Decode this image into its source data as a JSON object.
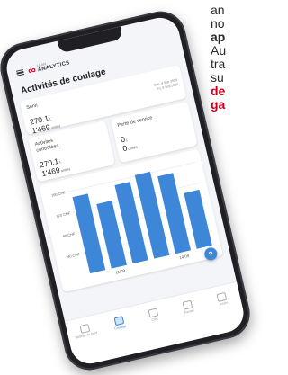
{
  "side_text": {
    "line1": "an",
    "line2": "no",
    "line3": "ap",
    "line4": "Au",
    "line5": "tra",
    "line6": "su",
    "line7": "de",
    "line8": "ga"
  },
  "app": {
    "logo_small": "LEAN",
    "logo_big": "ANALYTICS",
    "title": "Activités de coulage"
  },
  "servi": {
    "label": "Servi",
    "value1": "270.1",
    "unit1": "L",
    "value2": "1'469",
    "unit2": "unités",
    "date1": "Mon, 4 Sep 2023",
    "date2": "Fri, 8 Sep 2023"
  },
  "activites": {
    "label_line1": "Activités",
    "label_line2": "contrôlées",
    "value1": "270.1",
    "unit1": "L",
    "value2": "1'469",
    "unit2": "unités"
  },
  "perte": {
    "label": "Perte de service",
    "value1": "0",
    "unit1": "L",
    "value2": "0",
    "unit2": "unités"
  },
  "fab_label": "?",
  "chart_data": {
    "type": "bar",
    "categories": [
      "",
      "11/09",
      "",
      "",
      "14/09",
      ""
    ],
    "values": [
      148,
      125,
      152,
      162,
      150,
      108
    ],
    "y_ticks": [
      "160 CHF",
      "120 CHF",
      "80 CHF",
      "40 CHF"
    ],
    "y_tick_values": [
      160,
      120,
      80,
      40
    ],
    "ylim": [
      0,
      170
    ],
    "bar_color": "#3d86d8"
  },
  "nav": [
    {
      "label": "Tableau de bord",
      "active": false
    },
    {
      "label": "Coulage",
      "active": true
    },
    {
      "label": "Clés",
      "active": false
    },
    {
      "label": "Équipe",
      "active": false
    },
    {
      "label": "Avoirs",
      "active": false
    }
  ]
}
